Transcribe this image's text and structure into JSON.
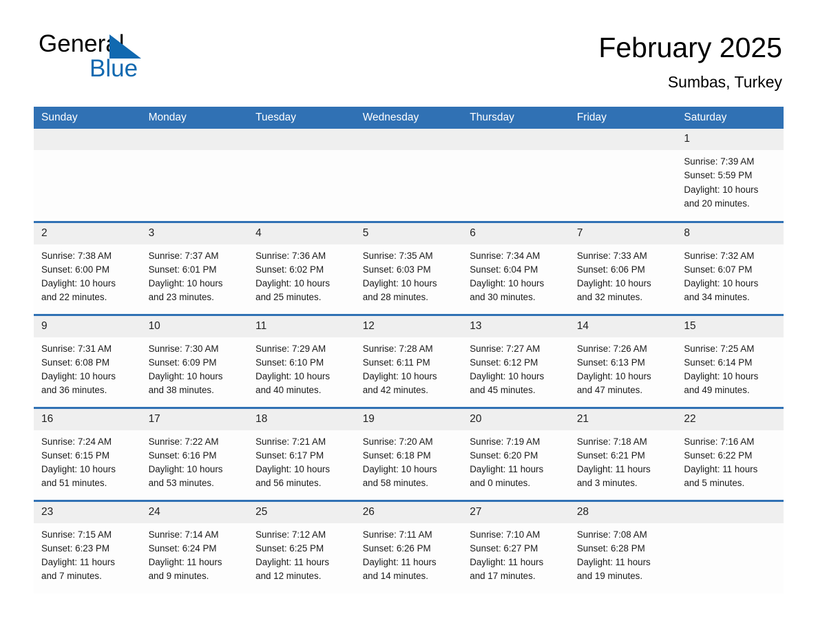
{
  "brand": {
    "name_dark": "General",
    "name_light": "Blue",
    "accent_color": "#1169b0"
  },
  "header": {
    "title": "February 2025",
    "subtitle": "Sumbas, Turkey"
  },
  "theme": {
    "header_blue": "#3071b4",
    "daynum_band": "#efefef",
    "cell_bg": "#fdfdfd"
  },
  "weekday_headers": [
    "Sunday",
    "Monday",
    "Tuesday",
    "Wednesday",
    "Thursday",
    "Friday",
    "Saturday"
  ],
  "weeks": [
    [
      {
        "day": "",
        "empty": true,
        "sunrise": "",
        "sunset": "",
        "daylight_1": "",
        "daylight_2": ""
      },
      {
        "day": "",
        "empty": true,
        "sunrise": "",
        "sunset": "",
        "daylight_1": "",
        "daylight_2": ""
      },
      {
        "day": "",
        "empty": true,
        "sunrise": "",
        "sunset": "",
        "daylight_1": "",
        "daylight_2": ""
      },
      {
        "day": "",
        "empty": true,
        "sunrise": "",
        "sunset": "",
        "daylight_1": "",
        "daylight_2": ""
      },
      {
        "day": "",
        "empty": true,
        "sunrise": "",
        "sunset": "",
        "daylight_1": "",
        "daylight_2": ""
      },
      {
        "day": "",
        "empty": true,
        "sunrise": "",
        "sunset": "",
        "daylight_1": "",
        "daylight_2": ""
      },
      {
        "day": "1",
        "empty": false,
        "sunrise": "Sunrise: 7:39 AM",
        "sunset": "Sunset: 5:59 PM",
        "daylight_1": "Daylight: 10 hours",
        "daylight_2": "and 20 minutes."
      }
    ],
    [
      {
        "day": "2",
        "empty": false,
        "sunrise": "Sunrise: 7:38 AM",
        "sunset": "Sunset: 6:00 PM",
        "daylight_1": "Daylight: 10 hours",
        "daylight_2": "and 22 minutes."
      },
      {
        "day": "3",
        "empty": false,
        "sunrise": "Sunrise: 7:37 AM",
        "sunset": "Sunset: 6:01 PM",
        "daylight_1": "Daylight: 10 hours",
        "daylight_2": "and 23 minutes."
      },
      {
        "day": "4",
        "empty": false,
        "sunrise": "Sunrise: 7:36 AM",
        "sunset": "Sunset: 6:02 PM",
        "daylight_1": "Daylight: 10 hours",
        "daylight_2": "and 25 minutes."
      },
      {
        "day": "5",
        "empty": false,
        "sunrise": "Sunrise: 7:35 AM",
        "sunset": "Sunset: 6:03 PM",
        "daylight_1": "Daylight: 10 hours",
        "daylight_2": "and 28 minutes."
      },
      {
        "day": "6",
        "empty": false,
        "sunrise": "Sunrise: 7:34 AM",
        "sunset": "Sunset: 6:04 PM",
        "daylight_1": "Daylight: 10 hours",
        "daylight_2": "and 30 minutes."
      },
      {
        "day": "7",
        "empty": false,
        "sunrise": "Sunrise: 7:33 AM",
        "sunset": "Sunset: 6:06 PM",
        "daylight_1": "Daylight: 10 hours",
        "daylight_2": "and 32 minutes."
      },
      {
        "day": "8",
        "empty": false,
        "sunrise": "Sunrise: 7:32 AM",
        "sunset": "Sunset: 6:07 PM",
        "daylight_1": "Daylight: 10 hours",
        "daylight_2": "and 34 minutes."
      }
    ],
    [
      {
        "day": "9",
        "empty": false,
        "sunrise": "Sunrise: 7:31 AM",
        "sunset": "Sunset: 6:08 PM",
        "daylight_1": "Daylight: 10 hours",
        "daylight_2": "and 36 minutes."
      },
      {
        "day": "10",
        "empty": false,
        "sunrise": "Sunrise: 7:30 AM",
        "sunset": "Sunset: 6:09 PM",
        "daylight_1": "Daylight: 10 hours",
        "daylight_2": "and 38 minutes."
      },
      {
        "day": "11",
        "empty": false,
        "sunrise": "Sunrise: 7:29 AM",
        "sunset": "Sunset: 6:10 PM",
        "daylight_1": "Daylight: 10 hours",
        "daylight_2": "and 40 minutes."
      },
      {
        "day": "12",
        "empty": false,
        "sunrise": "Sunrise: 7:28 AM",
        "sunset": "Sunset: 6:11 PM",
        "daylight_1": "Daylight: 10 hours",
        "daylight_2": "and 42 minutes."
      },
      {
        "day": "13",
        "empty": false,
        "sunrise": "Sunrise: 7:27 AM",
        "sunset": "Sunset: 6:12 PM",
        "daylight_1": "Daylight: 10 hours",
        "daylight_2": "and 45 minutes."
      },
      {
        "day": "14",
        "empty": false,
        "sunrise": "Sunrise: 7:26 AM",
        "sunset": "Sunset: 6:13 PM",
        "daylight_1": "Daylight: 10 hours",
        "daylight_2": "and 47 minutes."
      },
      {
        "day": "15",
        "empty": false,
        "sunrise": "Sunrise: 7:25 AM",
        "sunset": "Sunset: 6:14 PM",
        "daylight_1": "Daylight: 10 hours",
        "daylight_2": "and 49 minutes."
      }
    ],
    [
      {
        "day": "16",
        "empty": false,
        "sunrise": "Sunrise: 7:24 AM",
        "sunset": "Sunset: 6:15 PM",
        "daylight_1": "Daylight: 10 hours",
        "daylight_2": "and 51 minutes."
      },
      {
        "day": "17",
        "empty": false,
        "sunrise": "Sunrise: 7:22 AM",
        "sunset": "Sunset: 6:16 PM",
        "daylight_1": "Daylight: 10 hours",
        "daylight_2": "and 53 minutes."
      },
      {
        "day": "18",
        "empty": false,
        "sunrise": "Sunrise: 7:21 AM",
        "sunset": "Sunset: 6:17 PM",
        "daylight_1": "Daylight: 10 hours",
        "daylight_2": "and 56 minutes."
      },
      {
        "day": "19",
        "empty": false,
        "sunrise": "Sunrise: 7:20 AM",
        "sunset": "Sunset: 6:18 PM",
        "daylight_1": "Daylight: 10 hours",
        "daylight_2": "and 58 minutes."
      },
      {
        "day": "20",
        "empty": false,
        "sunrise": "Sunrise: 7:19 AM",
        "sunset": "Sunset: 6:20 PM",
        "daylight_1": "Daylight: 11 hours",
        "daylight_2": "and 0 minutes."
      },
      {
        "day": "21",
        "empty": false,
        "sunrise": "Sunrise: 7:18 AM",
        "sunset": "Sunset: 6:21 PM",
        "daylight_1": "Daylight: 11 hours",
        "daylight_2": "and 3 minutes."
      },
      {
        "day": "22",
        "empty": false,
        "sunrise": "Sunrise: 7:16 AM",
        "sunset": "Sunset: 6:22 PM",
        "daylight_1": "Daylight: 11 hours",
        "daylight_2": "and 5 minutes."
      }
    ],
    [
      {
        "day": "23",
        "empty": false,
        "sunrise": "Sunrise: 7:15 AM",
        "sunset": "Sunset: 6:23 PM",
        "daylight_1": "Daylight: 11 hours",
        "daylight_2": "and 7 minutes."
      },
      {
        "day": "24",
        "empty": false,
        "sunrise": "Sunrise: 7:14 AM",
        "sunset": "Sunset: 6:24 PM",
        "daylight_1": "Daylight: 11 hours",
        "daylight_2": "and 9 minutes."
      },
      {
        "day": "25",
        "empty": false,
        "sunrise": "Sunrise: 7:12 AM",
        "sunset": "Sunset: 6:25 PM",
        "daylight_1": "Daylight: 11 hours",
        "daylight_2": "and 12 minutes."
      },
      {
        "day": "26",
        "empty": false,
        "sunrise": "Sunrise: 7:11 AM",
        "sunset": "Sunset: 6:26 PM",
        "daylight_1": "Daylight: 11 hours",
        "daylight_2": "and 14 minutes."
      },
      {
        "day": "27",
        "empty": false,
        "sunrise": "Sunrise: 7:10 AM",
        "sunset": "Sunset: 6:27 PM",
        "daylight_1": "Daylight: 11 hours",
        "daylight_2": "and 17 minutes."
      },
      {
        "day": "28",
        "empty": false,
        "sunrise": "Sunrise: 7:08 AM",
        "sunset": "Sunset: 6:28 PM",
        "daylight_1": "Daylight: 11 hours",
        "daylight_2": "and 19 minutes."
      },
      {
        "day": "",
        "empty": true,
        "sunrise": "",
        "sunset": "",
        "daylight_1": "",
        "daylight_2": ""
      }
    ]
  ]
}
